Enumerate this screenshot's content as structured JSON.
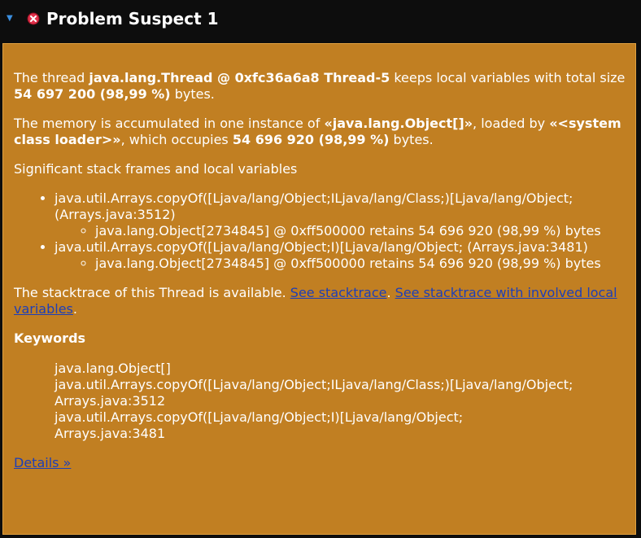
{
  "header": {
    "toggle_glyph": "▼",
    "title": "Problem Suspect 1",
    "status_icon": "error-x-icon"
  },
  "summary": {
    "p1_pre": "The thread ",
    "p1_thread": "java.lang.Thread @ 0xfc36a6a8 Thread-5",
    "p1_mid": " keeps local variables with total size ",
    "p1_size": "54 697 200 (98,99 %)",
    "p1_post": " bytes.",
    "p2_pre": "The memory is accumulated in one instance of ",
    "p2_class": "«java.lang.Object[]»",
    "p2_mid1": ", loaded by ",
    "p2_loader": "«<system class loader>»",
    "p2_mid2": ", which occupies ",
    "p2_size": "54 696 920 (98,99 %)",
    "p2_post": " bytes.",
    "frames_heading": "Significant stack frames and local variables"
  },
  "frames": [
    {
      "method": "java.util.Arrays.copyOf([Ljava/lang/Object;ILjava/lang/Class;)[Ljava/lang/Object; (Arrays.java:3512)",
      "var": "java.lang.Object[2734845] @ 0xff500000 retains 54 696 920 (98,99 %) bytes"
    },
    {
      "method": "java.util.Arrays.copyOf([Ljava/lang/Object;I)[Ljava/lang/Object; (Arrays.java:3481)",
      "var": "java.lang.Object[2734845] @ 0xff500000 retains 54 696 920 (98,99 %) bytes"
    }
  ],
  "stacktrace": {
    "pre": "The stacktrace of this Thread is available. ",
    "link1": "See stacktrace",
    "sep": ". ",
    "link2": "See stacktrace with involved local variables",
    "post": "."
  },
  "keywords": {
    "title": "Keywords",
    "items": [
      "java.lang.Object[]",
      "java.util.Arrays.copyOf([Ljava/lang/Object;ILjava/lang/Class;)[Ljava/lang/Object;",
      "Arrays.java:3512",
      "java.util.Arrays.copyOf([Ljava/lang/Object;I)[Ljava/lang/Object;",
      "Arrays.java:3481"
    ]
  },
  "details_link": "Details »",
  "colors": {
    "panel_bg": "#c17f22",
    "header_bg": "#0d0d0d",
    "link": "#1d3fb8",
    "icon_red": "#e0304a"
  }
}
